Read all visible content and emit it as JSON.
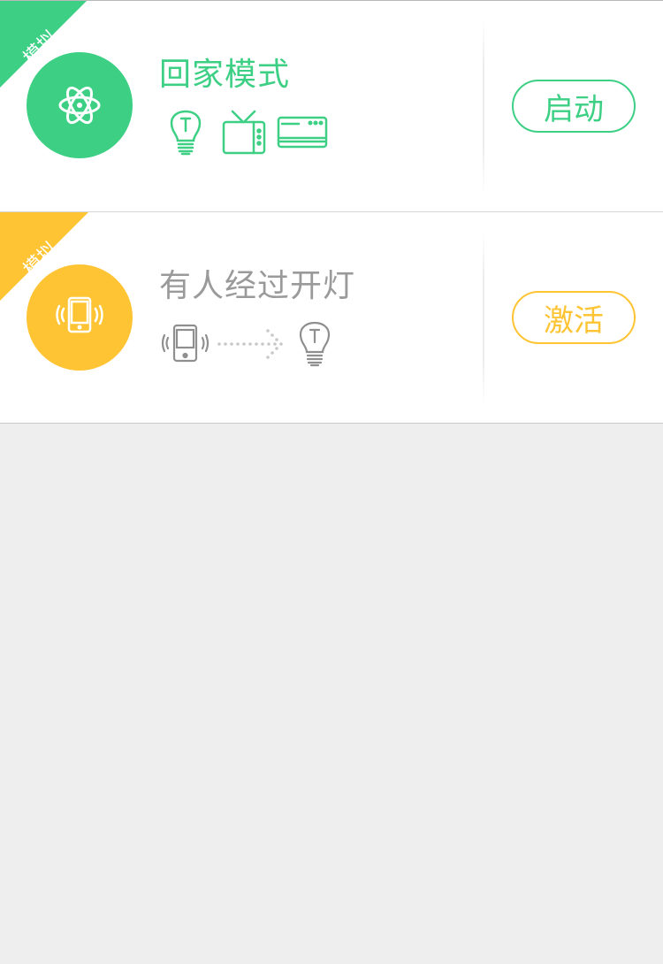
{
  "colors": {
    "green": "#3dd085",
    "yellow": "#fec433",
    "gray_text": "#9a9a9a",
    "gray_icon": "#8f8f8f",
    "background": "#eeeeee"
  },
  "scenes": [
    {
      "badge": "模拟",
      "title": "回家模式",
      "avatar_icon": "atom-icon",
      "device_icons": [
        "lightbulb-icon",
        "tv-icon",
        "air-conditioner-icon"
      ],
      "action_label": "启动"
    },
    {
      "badge": "模拟",
      "title": "有人经过开灯",
      "avatar_icon": "vibrating-phone-icon",
      "device_icons": [
        "vibrating-phone-icon",
        "dotted-arrow-icon",
        "lightbulb-icon"
      ],
      "action_label": "激活"
    }
  ]
}
